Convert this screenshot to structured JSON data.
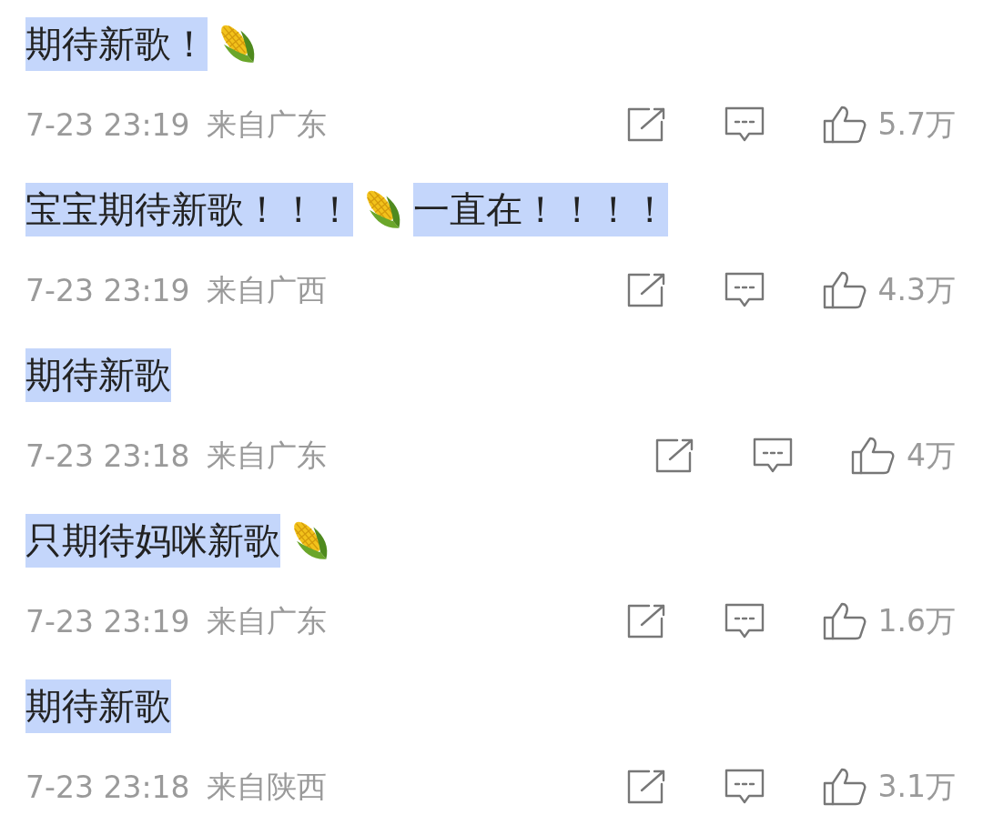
{
  "comments": [
    {
      "content": [
        {
          "kind": "text",
          "text": "期待新歌！",
          "highlighted": true
        },
        {
          "kind": "corn"
        }
      ],
      "date": "7-23 23:19",
      "location": "来自广东",
      "likes": "5.7万"
    },
    {
      "content": [
        {
          "kind": "text",
          "text": "宝宝期待新歌！！！",
          "highlighted": true
        },
        {
          "kind": "corn"
        },
        {
          "kind": "text",
          "text": "一直在！！！！",
          "highlighted": true
        }
      ],
      "date": "7-23 23:19",
      "location": "来自广西",
      "likes": "4.3万"
    },
    {
      "content": [
        {
          "kind": "text",
          "text": "期待新歌",
          "highlighted": true
        }
      ],
      "date": "7-23 23:18",
      "location": "来自广东",
      "likes": "4万"
    },
    {
      "content": [
        {
          "kind": "text",
          "text": "只期待妈咪新歌",
          "highlighted": true
        },
        {
          "kind": "corn"
        }
      ],
      "date": "7-23 23:19",
      "location": "来自广东",
      "likes": "1.6万"
    },
    {
      "content": [
        {
          "kind": "text",
          "text": "期待新歌",
          "highlighted": true
        }
      ],
      "date": "7-23 23:18",
      "location": "来自陕西",
      "likes": "3.1万"
    }
  ]
}
